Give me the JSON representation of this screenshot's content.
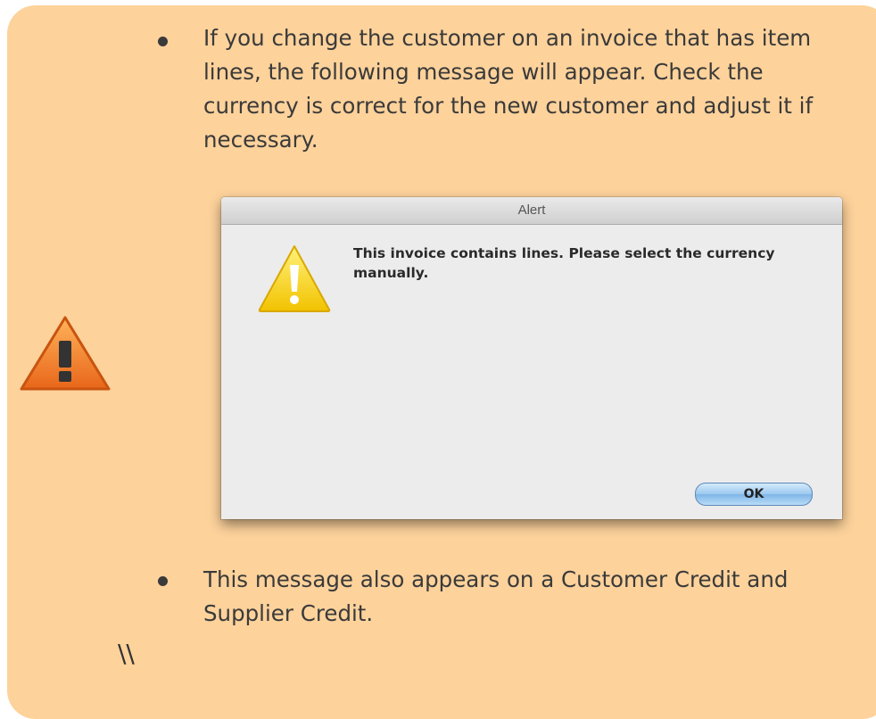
{
  "bullets": [
    "If you change the customer on an invoice that has item lines, the following message will appear. Check the currency is correct for the new customer and adjust it if necessary.",
    "This message also appears on a Customer Credit and Supplier Credit."
  ],
  "alert": {
    "title": "Alert",
    "message": "This invoice contains lines. Please select the currency manually.",
    "ok_label": "OK"
  },
  "trailing_text": "\\\\",
  "colors": {
    "note_background": "#fdd29b",
    "warning_orange": "#f08a24",
    "warning_yellow": "#ffd700",
    "ok_button_blue": "#9cc8ef"
  },
  "icons": [
    "warning-icon",
    "alert-warning-icon"
  ]
}
